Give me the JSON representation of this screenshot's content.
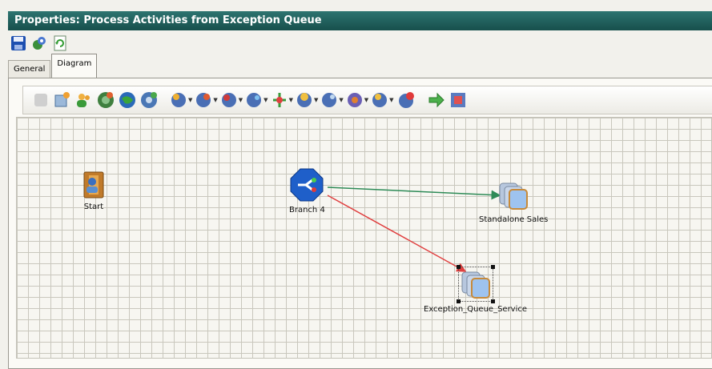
{
  "window": {
    "title": "Properties: Process Activities from Exception Queue"
  },
  "main_toolbar": {
    "items": [
      "save-icon",
      "refresh-settings-icon",
      "reload-icon"
    ]
  },
  "tabs": [
    {
      "label": "General",
      "active": false
    },
    {
      "label": "Diagram",
      "active": true
    }
  ],
  "diagram_toolbar": {
    "buttons": [
      "disabled-icon",
      "new-activity-icon",
      "users-icon",
      "activity-icon",
      "globe-icon",
      "process-icon",
      "dropdown-icon-1",
      "dropdown-icon-2",
      "dropdown-icon-3",
      "dropdown-icon-4",
      "branch-dropdown-icon",
      "dropdown-icon-5",
      "dropdown-icon-6",
      "dropdown-icon-7",
      "dropdown-icon-8",
      "delete-activity-icon",
      "arrow-right-icon",
      "layout-icon"
    ]
  },
  "diagram": {
    "nodes": [
      {
        "id": "start",
        "label": "Start",
        "type": "start"
      },
      {
        "id": "branch",
        "label": "Branch 4",
        "type": "branch"
      },
      {
        "id": "sales",
        "label": "Standalone Sales",
        "type": "service"
      },
      {
        "id": "exception",
        "label": "Exception_Queue_Service",
        "type": "service",
        "selected": true
      }
    ],
    "connections": [
      {
        "from": "branch",
        "to": "sales",
        "color": "#2e8b57"
      },
      {
        "from": "branch",
        "to": "exception",
        "color": "#e04040"
      }
    ]
  },
  "colors": {
    "title_bar": "#1f5e5b",
    "grid": "#c9c7bd",
    "green_line": "#2e8b57",
    "red_line": "#e04040"
  }
}
